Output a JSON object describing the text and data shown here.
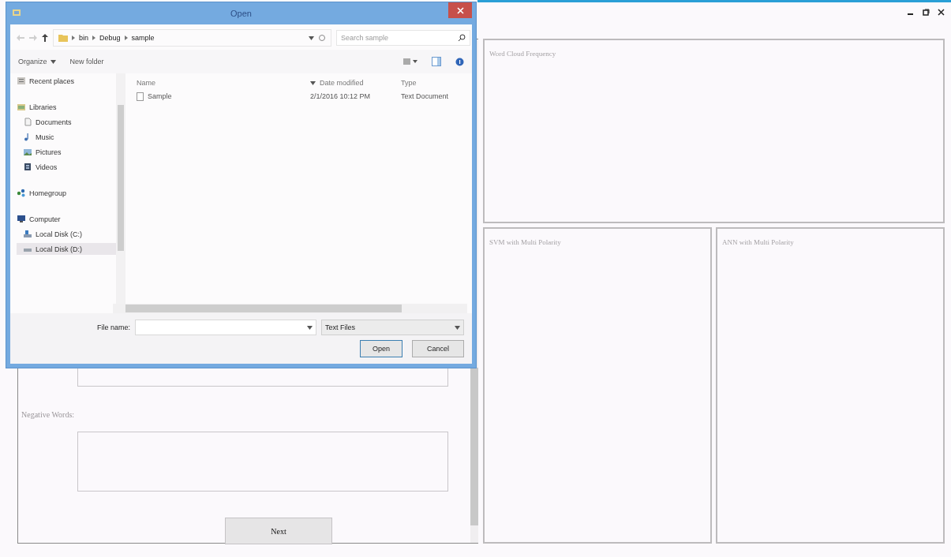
{
  "input_panel": {
    "negative_words_label": "Negative Words:",
    "next_button": "Next"
  },
  "result_panels": [
    {
      "title": "Word Cloud Frequency"
    },
    {
      "title": "SVM with Multi Polarity"
    },
    {
      "title": "ANN with Multi Polarity"
    }
  ],
  "open_dialog": {
    "title": "Open",
    "breadcrumb": [
      "bin",
      "Debug",
      "sample"
    ],
    "search": {
      "placeholder": "Search sample"
    },
    "toolbar": {
      "organize": "Organize",
      "new_folder": "New folder"
    },
    "nav": [
      {
        "label": "Recent places",
        "kind": "recent",
        "selected": false
      },
      {
        "label": "Libraries",
        "kind": "library",
        "selected": false,
        "children": [
          {
            "label": "Documents",
            "kind": "document",
            "selected": false
          },
          {
            "label": "Music",
            "kind": "music",
            "selected": false
          },
          {
            "label": "Pictures",
            "kind": "picture",
            "selected": false
          },
          {
            "label": "Videos",
            "kind": "video",
            "selected": false
          }
        ]
      },
      {
        "label": "Homegroup",
        "kind": "homegroup",
        "selected": false
      },
      {
        "label": "Computer",
        "kind": "computer",
        "selected": false,
        "children": [
          {
            "label": "Local Disk (C:)",
            "kind": "system-drive",
            "selected": false
          },
          {
            "label": "Local Disk (D:)",
            "kind": "drive",
            "selected": true
          }
        ]
      }
    ],
    "columns": [
      "Name",
      "Date modified",
      "Type"
    ],
    "files": [
      {
        "name": "Sample",
        "date": "2/1/2016 10:12 PM",
        "type": "Text Document",
        "selected": false
      }
    ],
    "file_name": {
      "label": "File name:"
    },
    "file_type": {
      "value": "Text Files"
    },
    "buttons": [
      "Open",
      "Cancel"
    ]
  }
}
